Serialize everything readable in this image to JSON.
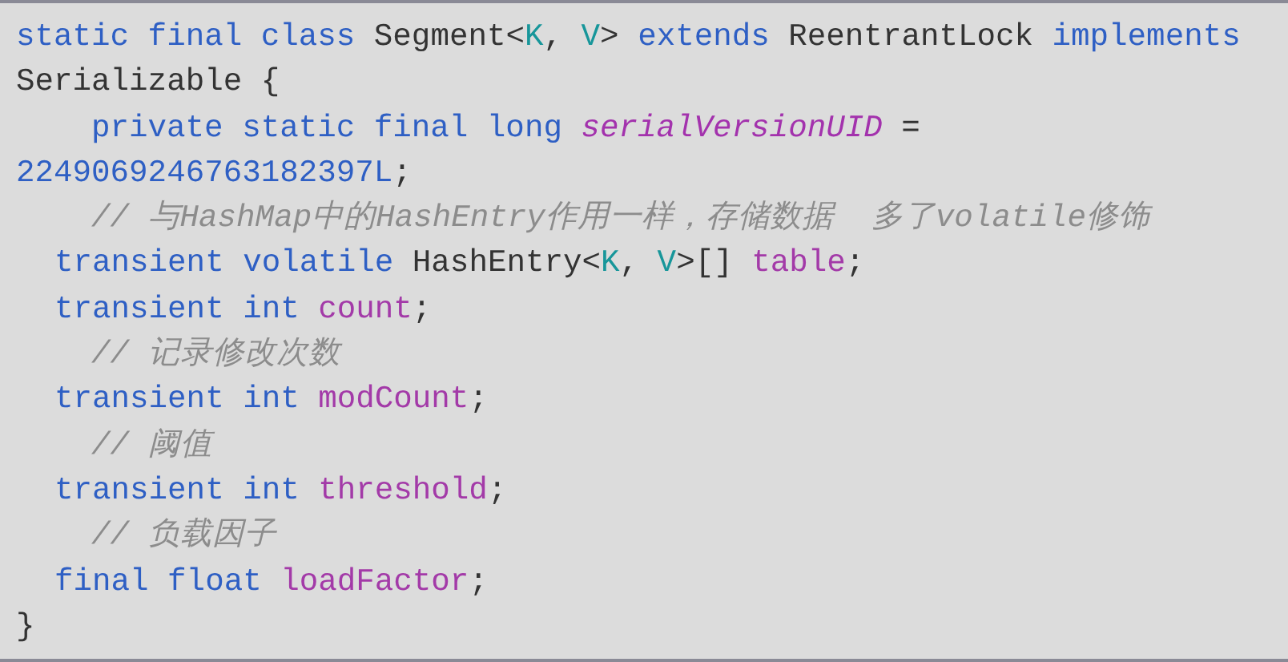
{
  "code_lines": [
    {
      "kind": "top",
      "tokens": [
        {
          "kind": "keyword",
          "text": "static final class"
        },
        {
          "kind": "plain",
          "text": " Segment<"
        },
        {
          "kind": "type_param",
          "text": "K"
        },
        {
          "kind": "plain",
          "text": ", "
        },
        {
          "kind": "type_param",
          "text": "V"
        },
        {
          "kind": "plain",
          "text": "> "
        },
        {
          "kind": "keyword",
          "text": "extends"
        },
        {
          "kind": "plain",
          "text": " ReentrantLock "
        },
        {
          "kind": "keyword",
          "text": "implements"
        }
      ]
    },
    {
      "kind": "top",
      "tokens": [
        {
          "kind": "plain",
          "text": "Serializable {"
        }
      ]
    },
    {
      "kind": "deep",
      "tokens": [
        {
          "kind": "keyword",
          "text": "private static final long"
        },
        {
          "kind": "constant",
          "text": " serialVersionUID"
        },
        {
          "kind": "plain",
          "text": " ="
        }
      ]
    },
    {
      "kind": "top",
      "tokens": [
        {
          "kind": "number",
          "text": "2249069246763182397L"
        },
        {
          "kind": "plain",
          "text": ";"
        }
      ]
    },
    {
      "kind": "comment",
      "tokens": [
        {
          "kind": "comment",
          "text": "// 与HashMap中的HashEntry作用一样，存储数据  多了volatile修饰"
        }
      ]
    },
    {
      "kind": "member",
      "tokens": [
        {
          "kind": "keyword",
          "text": "transient volatile"
        },
        {
          "kind": "plain",
          "text": " HashEntry<"
        },
        {
          "kind": "type_param",
          "text": "K"
        },
        {
          "kind": "plain",
          "text": ", "
        },
        {
          "kind": "type_param",
          "text": "V"
        },
        {
          "kind": "plain",
          "text": ">[] "
        },
        {
          "kind": "field",
          "text": "table"
        },
        {
          "kind": "plain",
          "text": ";"
        }
      ]
    },
    {
      "kind": "member",
      "tokens": [
        {
          "kind": "keyword",
          "text": "transient int"
        },
        {
          "kind": "field",
          "text": " count"
        },
        {
          "kind": "plain",
          "text": ";"
        }
      ]
    },
    {
      "kind": "comment",
      "tokens": [
        {
          "kind": "comment",
          "text": "// 记录修改次数"
        }
      ]
    },
    {
      "kind": "member",
      "tokens": [
        {
          "kind": "keyword",
          "text": "transient int"
        },
        {
          "kind": "field",
          "text": " modCount"
        },
        {
          "kind": "plain",
          "text": ";"
        }
      ]
    },
    {
      "kind": "comment",
      "tokens": [
        {
          "kind": "comment",
          "text": "// 阈值"
        }
      ]
    },
    {
      "kind": "member",
      "tokens": [
        {
          "kind": "keyword",
          "text": "transient int"
        },
        {
          "kind": "field",
          "text": " threshold"
        },
        {
          "kind": "plain",
          "text": ";"
        }
      ]
    },
    {
      "kind": "comment",
      "tokens": [
        {
          "kind": "comment",
          "text": "// 负载因子"
        }
      ]
    },
    {
      "kind": "member",
      "tokens": [
        {
          "kind": "keyword",
          "text": "final float"
        },
        {
          "kind": "field",
          "text": " loadFactor"
        },
        {
          "kind": "plain",
          "text": ";"
        }
      ]
    },
    {
      "kind": "top",
      "tokens": [
        {
          "kind": "plain",
          "text": "}"
        }
      ]
    }
  ]
}
